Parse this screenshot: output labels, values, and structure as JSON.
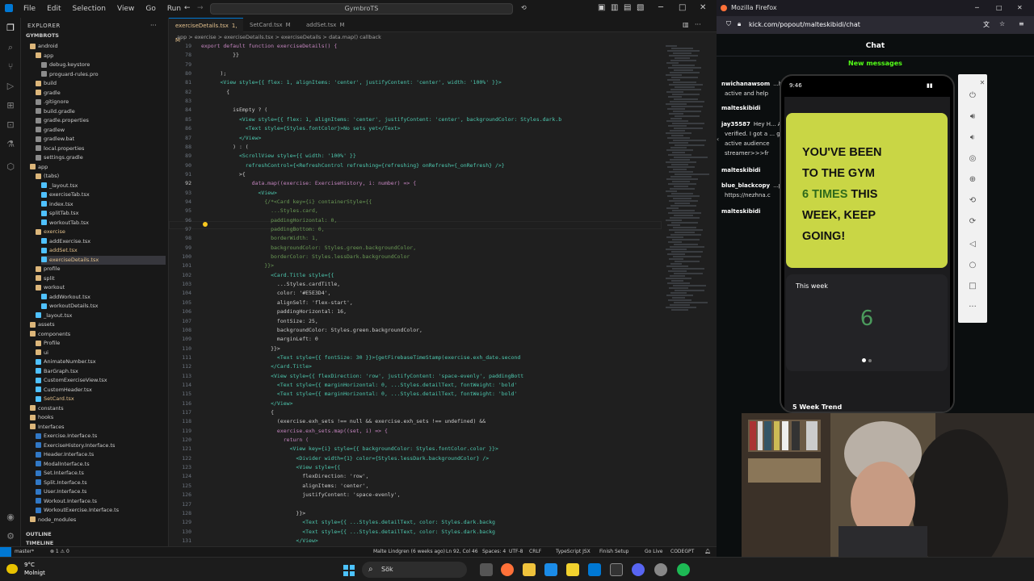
{
  "vscode": {
    "menu": [
      "File",
      "Edit",
      "Selection",
      "View",
      "Go",
      "Run"
    ],
    "search_text": "GymbroTS",
    "explorer_title": "EXPLORER",
    "project": "GYMBROTS",
    "tree": [
      {
        "label": "android",
        "kind": "folder",
        "depth": 1
      },
      {
        "label": "app",
        "kind": "folder",
        "depth": 2
      },
      {
        "label": "debug.keystore",
        "kind": "file",
        "depth": 3
      },
      {
        "label": "proguard-rules.pro",
        "kind": "file",
        "depth": 3
      },
      {
        "label": "build",
        "kind": "folder",
        "depth": 2
      },
      {
        "label": "gradle",
        "kind": "folder",
        "depth": 2
      },
      {
        "label": ".gitignore",
        "kind": "file",
        "depth": 2
      },
      {
        "label": "build.gradle",
        "kind": "file",
        "depth": 2
      },
      {
        "label": "gradle.properties",
        "kind": "file",
        "depth": 2
      },
      {
        "label": "gradlew",
        "kind": "file",
        "depth": 2
      },
      {
        "label": "gradlew.bat",
        "kind": "file",
        "depth": 2
      },
      {
        "label": "local.properties",
        "kind": "file",
        "depth": 2
      },
      {
        "label": "settings.gradle",
        "kind": "file",
        "depth": 2
      },
      {
        "label": "app",
        "kind": "folder",
        "depth": 1
      },
      {
        "label": "(tabs)",
        "kind": "folder",
        "depth": 2
      },
      {
        "label": "_layout.tsx",
        "kind": "tsx",
        "depth": 3
      },
      {
        "label": "exerciseTab.tsx",
        "kind": "tsx",
        "depth": 3
      },
      {
        "label": "index.tsx",
        "kind": "tsx",
        "depth": 3
      },
      {
        "label": "splitTab.tsx",
        "kind": "tsx",
        "depth": 3
      },
      {
        "label": "workoutTab.tsx",
        "kind": "tsx",
        "depth": 3
      },
      {
        "label": "exercise",
        "kind": "folder",
        "depth": 2,
        "mod": true
      },
      {
        "label": "addExercise.tsx",
        "kind": "tsx",
        "depth": 3
      },
      {
        "label": "addSet.tsx",
        "kind": "tsx",
        "depth": 3,
        "mod": true
      },
      {
        "label": "exerciseDetails.tsx",
        "kind": "tsx",
        "depth": 3,
        "mod": true,
        "selected": true
      },
      {
        "label": "profile",
        "kind": "folder",
        "depth": 2
      },
      {
        "label": "split",
        "kind": "folder",
        "depth": 2
      },
      {
        "label": "workout",
        "kind": "folder",
        "depth": 2
      },
      {
        "label": "addWorkout.tsx",
        "kind": "tsx",
        "depth": 3
      },
      {
        "label": "workoutDetails.tsx",
        "kind": "tsx",
        "depth": 3
      },
      {
        "label": "_layout.tsx",
        "kind": "tsx",
        "depth": 2
      },
      {
        "label": "assets",
        "kind": "folder",
        "depth": 1
      },
      {
        "label": "components",
        "kind": "folder",
        "depth": 1
      },
      {
        "label": "Profile",
        "kind": "folder",
        "depth": 2
      },
      {
        "label": "ui",
        "kind": "folder",
        "depth": 2
      },
      {
        "label": "AnimateNumber.tsx",
        "kind": "tsx",
        "depth": 2
      },
      {
        "label": "BarGraph.tsx",
        "kind": "tsx",
        "depth": 2
      },
      {
        "label": "CustomExerciseView.tsx",
        "kind": "tsx",
        "depth": 2
      },
      {
        "label": "CustomHeader.tsx",
        "kind": "tsx",
        "depth": 2
      },
      {
        "label": "SetCard.tsx",
        "kind": "tsx",
        "depth": 2,
        "mod": true
      },
      {
        "label": "constants",
        "kind": "folder",
        "depth": 1
      },
      {
        "label": "hooks",
        "kind": "folder",
        "depth": 1
      },
      {
        "label": "Interfaces",
        "kind": "folder",
        "depth": 1
      },
      {
        "label": "Exercise.Interface.ts",
        "kind": "ts",
        "depth": 2
      },
      {
        "label": "ExerciseHistory.Interface.ts",
        "kind": "ts",
        "depth": 2
      },
      {
        "label": "Header.Interface.ts",
        "kind": "ts",
        "depth": 2
      },
      {
        "label": "ModalInterface.ts",
        "kind": "ts",
        "depth": 2
      },
      {
        "label": "Set.Interface.ts",
        "kind": "ts",
        "depth": 2
      },
      {
        "label": "Split.Interface.ts",
        "kind": "ts",
        "depth": 2
      },
      {
        "label": "User.Interface.ts",
        "kind": "ts",
        "depth": 2
      },
      {
        "label": "Workout.Interface.ts",
        "kind": "ts",
        "depth": 2
      },
      {
        "label": "WorkoutExercise.Interface.ts",
        "kind": "ts",
        "depth": 2
      },
      {
        "label": "node_modules",
        "kind": "folder",
        "depth": 1
      }
    ],
    "outline_label": "OUTLINE",
    "timeline_label": "TIMELINE",
    "tabs": [
      {
        "label": "exerciseDetails.tsx",
        "suffix": "1, M",
        "active": true
      },
      {
        "label": "SetCard.tsx",
        "suffix": "M",
        "active": false
      },
      {
        "label": "addSet.tsx",
        "suffix": "M",
        "active": false
      }
    ],
    "breadcrumb": "app > exercise > exerciseDetails.tsx > exerciseDetails > data.map() callback",
    "code_lines": [
      {
        "n": "19",
        "t": "export default function exerciseDetails() {"
      },
      {
        "n": "78",
        "t": "          }}"
      },
      {
        "n": "79",
        "t": ""
      },
      {
        "n": "80",
        "t": "      );"
      },
      {
        "n": "81",
        "t": "      <View style={{ flex: 1, alignItems: 'center', justifyContent: 'center', width: '100%' }}>"
      },
      {
        "n": "82",
        "t": "        {"
      },
      {
        "n": "83",
        "t": ""
      },
      {
        "n": "84",
        "t": "          isEmpty ? ("
      },
      {
        "n": "85",
        "t": "            <View style={{ flex: 1, alignItems: 'center', justifyContent: 'center', backgroundColor: Styles.dark.b"
      },
      {
        "n": "86",
        "t": "              <Text style={Styles.fontColor}>No sets yet</Text>"
      },
      {
        "n": "87",
        "t": "            </View>"
      },
      {
        "n": "88",
        "t": "          ) : ("
      },
      {
        "n": "89",
        "t": "            <ScrollView style={{ width: '100%' }}"
      },
      {
        "n": "90",
        "t": "              refreshControl={<RefreshControl refreshing={refreshing} onRefresh={_onRefresh} />}"
      },
      {
        "n": "91",
        "t": "            >{"
      },
      {
        "n": "92",
        "t": "                data.map((exercise: ExerciseHistory, i: number) => {"
      },
      {
        "n": "93",
        "t": "                  <View>"
      },
      {
        "n": "94",
        "t": "                    {/*<Card key={i} containerStyle={{"
      },
      {
        "n": "95",
        "t": "                      ...Styles.card,"
      },
      {
        "n": "96",
        "t": "                      paddingHorizontal: 0,"
      },
      {
        "n": "97",
        "t": "                      paddingBottom: 0,"
      },
      {
        "n": "98",
        "t": "                      borderWidth: 1,"
      },
      {
        "n": "99",
        "t": "                      backgroundColor: Styles.green.backgroundColor,"
      },
      {
        "n": "100",
        "t": "                      borderColor: Styles.lessDark.backgroundColor"
      },
      {
        "n": "101",
        "t": "                    }}>"
      },
      {
        "n": "102",
        "t": "                      <Card.Title style={{"
      },
      {
        "n": "103",
        "t": "                        ...Styles.cardTitle,"
      },
      {
        "n": "104",
        "t": "                        color: '#E5E3D4',"
      },
      {
        "n": "105",
        "t": "                        alignSelf: 'flex-start',"
      },
      {
        "n": "106",
        "t": "                        paddingHorizontal: 16,"
      },
      {
        "n": "107",
        "t": "                        fontSize: 25,"
      },
      {
        "n": "108",
        "t": "                        backgroundColor: Styles.green.backgroundColor,"
      },
      {
        "n": "109",
        "t": "                        marginLeft: 0"
      },
      {
        "n": "110",
        "t": "                      }}>"
      },
      {
        "n": "111",
        "t": "                        <Text style={{ fontSize: 30 }}>{getFirebaseTimeStamp(exercise.exh_date.second"
      },
      {
        "n": "112",
        "t": "                      </Card.Title>"
      },
      {
        "n": "113",
        "t": "                      <View style={{ flexDirection: 'row', justifyContent: 'space-evenly', paddingBott"
      },
      {
        "n": "114",
        "t": "                        <Text style={{ marginHorizontal: 0, ...Styles.detailText, fontWeight: 'bold'"
      },
      {
        "n": "115",
        "t": "                        <Text style={{ marginHorizontal: 0, ...Styles.detailText, fontWeight: 'bold'"
      },
      {
        "n": "116",
        "t": "                      </View>"
      },
      {
        "n": "117",
        "t": "                      {"
      },
      {
        "n": "118",
        "t": "                        (exercise.exh_sets !== null && exercise.exh_sets !== undefined) &&"
      },
      {
        "n": "119",
        "t": "                        exercise.exh_sets.map((set, i) => {"
      },
      {
        "n": "120",
        "t": "                          return ("
      },
      {
        "n": "121",
        "t": "                            <View key={i} style={{ backgroundColor: Styles.fontColor.color }}>"
      },
      {
        "n": "122",
        "t": "                              <Divider width={1} color={Styles.lessDark.backgroundColor} />"
      },
      {
        "n": "123",
        "t": "                              <View style={{"
      },
      {
        "n": "124",
        "t": "                                flexDirection: 'row',"
      },
      {
        "n": "125",
        "t": "                                alignItems: 'center',"
      },
      {
        "n": "126",
        "t": "                                justifyContent: 'space-evenly',"
      },
      {
        "n": "127",
        "t": ""
      },
      {
        "n": "128",
        "t": "                              }}>"
      },
      {
        "n": "129",
        "t": "                                <Text style={{ ...Styles.detailText, color: Styles.dark.backg"
      },
      {
        "n": "130",
        "t": "                                <Text style={{ ...Styles.detailText, color: Styles.dark.backg"
      },
      {
        "n": "131",
        "t": "                              </View>"
      }
    ],
    "status": {
      "branch": "master*",
      "errors": "⊗ 1 ⚠ 0",
      "blame": "Malte Lindgren (6 weeks ago)",
      "position": "Ln 92, Col 46",
      "spaces": "Spaces: 4",
      "encoding": "UTF-8",
      "eol": "CRLF",
      "language": "TypeScript JSX",
      "finish": "Finish Setup",
      "golive": "Go Live",
      "codegpt": "CODEGPT"
    }
  },
  "firefox": {
    "title": "Mozilla Firefox",
    "url": "kick.com/popout/malteskibidi/chat",
    "chat_title": "Chat",
    "new_messages": "New messages",
    "messages": [
      {
        "name": "nwichanawsom",
        "text": "...help your chat"
      },
      {
        "name": "",
        "text": "active and help"
      },
      {
        "name": "malteskibidi",
        "text": ""
      },
      {
        "name": "jay35587",
        "text": "Hey H... Affiliated and"
      },
      {
        "name": "",
        "text": "verified. I got a ... gain 1000"
      },
      {
        "name": "",
        "text": "active audience"
      },
      {
        "name": "",
        "text": "streamer>>>fr"
      },
      {
        "name": "malteskibidi",
        "text": ""
      },
      {
        "name": "blue_blackcopy",
        "text": "...popular"
      },
      {
        "name": "",
        "text": "https://nezhna.c"
      },
      {
        "name": "malteskibidi",
        "text": ""
      },
      {
        "name": "malteskibidi",
        "text": ""
      }
    ]
  },
  "phone": {
    "time": "9:46",
    "card_line1": "YOU'VE BEEN",
    "card_line2": "TO THE GYM",
    "card_accent": "6 TIMES",
    "card_line3": " THIS",
    "card_line4": "WEEK, KEEP",
    "card_line5": "GOING!",
    "this_week": "This week",
    "week_count": "6",
    "trend": "5 Week Trend"
  },
  "taskbar": {
    "temp": "9°C",
    "weather": "Molnigt",
    "search": "Sök"
  },
  "colors": {
    "accent_green": "#53fc18",
    "card_yellow": "#c9d645",
    "count_green": "#4b9a5c"
  }
}
